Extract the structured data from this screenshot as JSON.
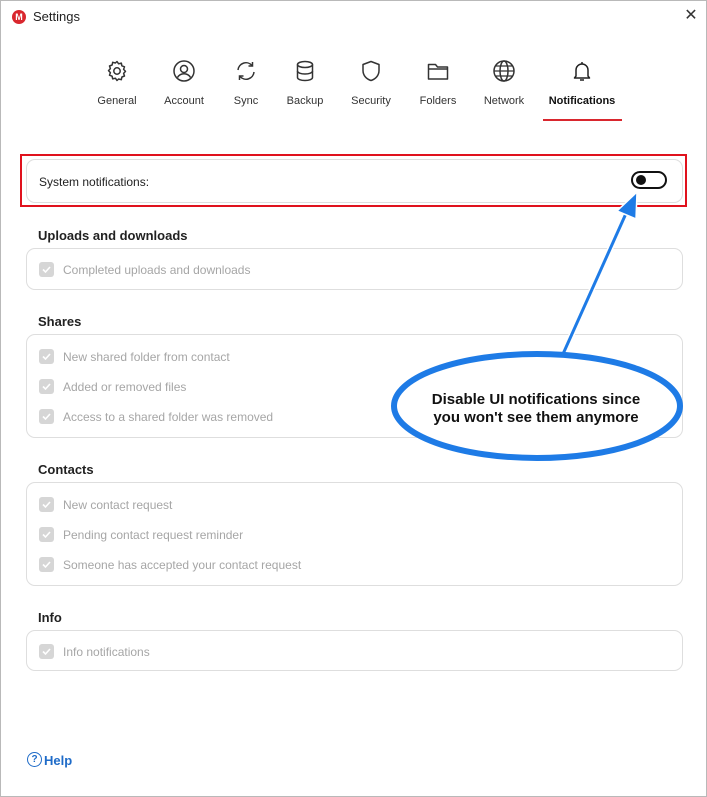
{
  "window": {
    "logo_letter": "M",
    "title": "Settings",
    "close_glyph": "✕"
  },
  "tabs": [
    {
      "label": "General",
      "icon": "gear-icon"
    },
    {
      "label": "Account",
      "icon": "account-icon"
    },
    {
      "label": "Sync",
      "icon": "sync-icon"
    },
    {
      "label": "Backup",
      "icon": "database-icon"
    },
    {
      "label": "Security",
      "icon": "shield-icon"
    },
    {
      "label": "Folders",
      "icon": "folder-icon"
    },
    {
      "label": "Network",
      "icon": "globe-icon"
    },
    {
      "label": "Notifications",
      "icon": "bell-icon",
      "active": true
    }
  ],
  "system_notifications": {
    "label": "System notifications:",
    "enabled": true
  },
  "sections": {
    "uploads": {
      "title": "Uploads and downloads",
      "items": [
        "Completed uploads and downloads"
      ]
    },
    "shares": {
      "title": "Shares",
      "items": [
        "New shared folder from contact",
        "Added or removed files",
        "Access to a shared folder was removed"
      ]
    },
    "contacts": {
      "title": "Contacts",
      "items": [
        "New contact request",
        "Pending contact request reminder",
        "Someone has accepted your contact request"
      ]
    },
    "info": {
      "title": "Info",
      "items": [
        "Info notifications"
      ]
    }
  },
  "help": {
    "label": "Help",
    "icon_glyph": "?"
  },
  "annotation": {
    "line1": "Disable UI notifications since",
    "line2": "you won't see them anymore"
  },
  "colors": {
    "accent": "#d9272e",
    "highlight_border": "#e0121d",
    "callout_blue": "#1e7be6",
    "help_link": "#1e6bc8"
  }
}
